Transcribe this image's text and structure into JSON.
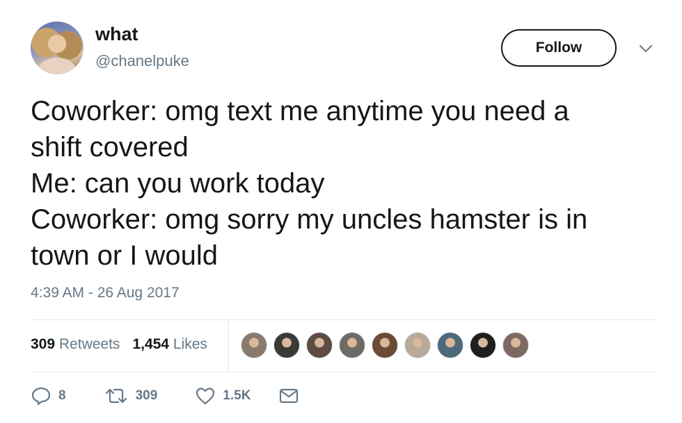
{
  "user": {
    "display_name": "what",
    "handle": "@chanelpuke"
  },
  "follow_label": "Follow",
  "tweet": {
    "lines": [
      "Coworker: omg text me anytime you need a",
      "shift covered",
      "Me: can you work today",
      "Coworker: omg sorry my uncles hamster is in",
      "town or I would"
    ],
    "timestamp": "4:39 AM - 26 Aug 2017"
  },
  "stats": {
    "retweets_count": "309",
    "retweets_label": "Retweets",
    "likes_count": "1,454",
    "likes_label": "Likes"
  },
  "likers": [
    {
      "color": "#8a7a6e"
    },
    {
      "color": "#3b3b36"
    },
    {
      "color": "#5e4c43"
    },
    {
      "color": "#6e6a64"
    },
    {
      "color": "#6b4a36"
    },
    {
      "color": "#b8a99a"
    },
    {
      "color": "#4d6a7a"
    },
    {
      "color": "#1f1f1f"
    },
    {
      "color": "#7c6a62"
    }
  ],
  "actions": {
    "reply_count": "8",
    "retweet_count": "309",
    "like_count": "1.5K"
  },
  "icons": [
    "reply-icon",
    "retweet-icon",
    "heart-icon",
    "envelope-icon",
    "chevron-down-icon"
  ],
  "colors": {
    "text": "#14171a",
    "secondary": "#657786",
    "divider": "#e1e8ed"
  }
}
